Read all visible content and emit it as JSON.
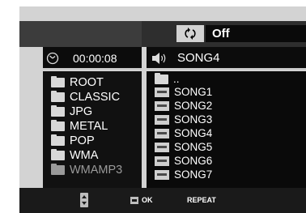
{
  "header": {
    "repeat_value": "Off"
  },
  "status": {
    "time": "00:00:08",
    "current_song": "SONG4"
  },
  "folders": {
    "items": [
      {
        "label": "ROOT"
      },
      {
        "label": "CLASSIC"
      },
      {
        "label": "JPG"
      },
      {
        "label": "METAL"
      },
      {
        "label": "POP"
      },
      {
        "label": "WMA"
      },
      {
        "label": "WMAMP3"
      }
    ]
  },
  "files": {
    "parent": "..",
    "items": [
      {
        "label": "SONG1"
      },
      {
        "label": "SONG2"
      },
      {
        "label": "SONG3"
      },
      {
        "label": "SONG4"
      },
      {
        "label": "SONG5"
      },
      {
        "label": "SONG6"
      },
      {
        "label": "SONG7"
      }
    ]
  },
  "footer": {
    "ok_label": "OK",
    "repeat_label": "REPEAT"
  },
  "icons": {
    "repeat": "repeat-icon",
    "clock": "clock-icon",
    "speaker": "speaker-icon",
    "folder": "folder-icon",
    "mp3": "mp3-file-icon",
    "updown": "up-down-icon",
    "enter": "enter-icon"
  }
}
